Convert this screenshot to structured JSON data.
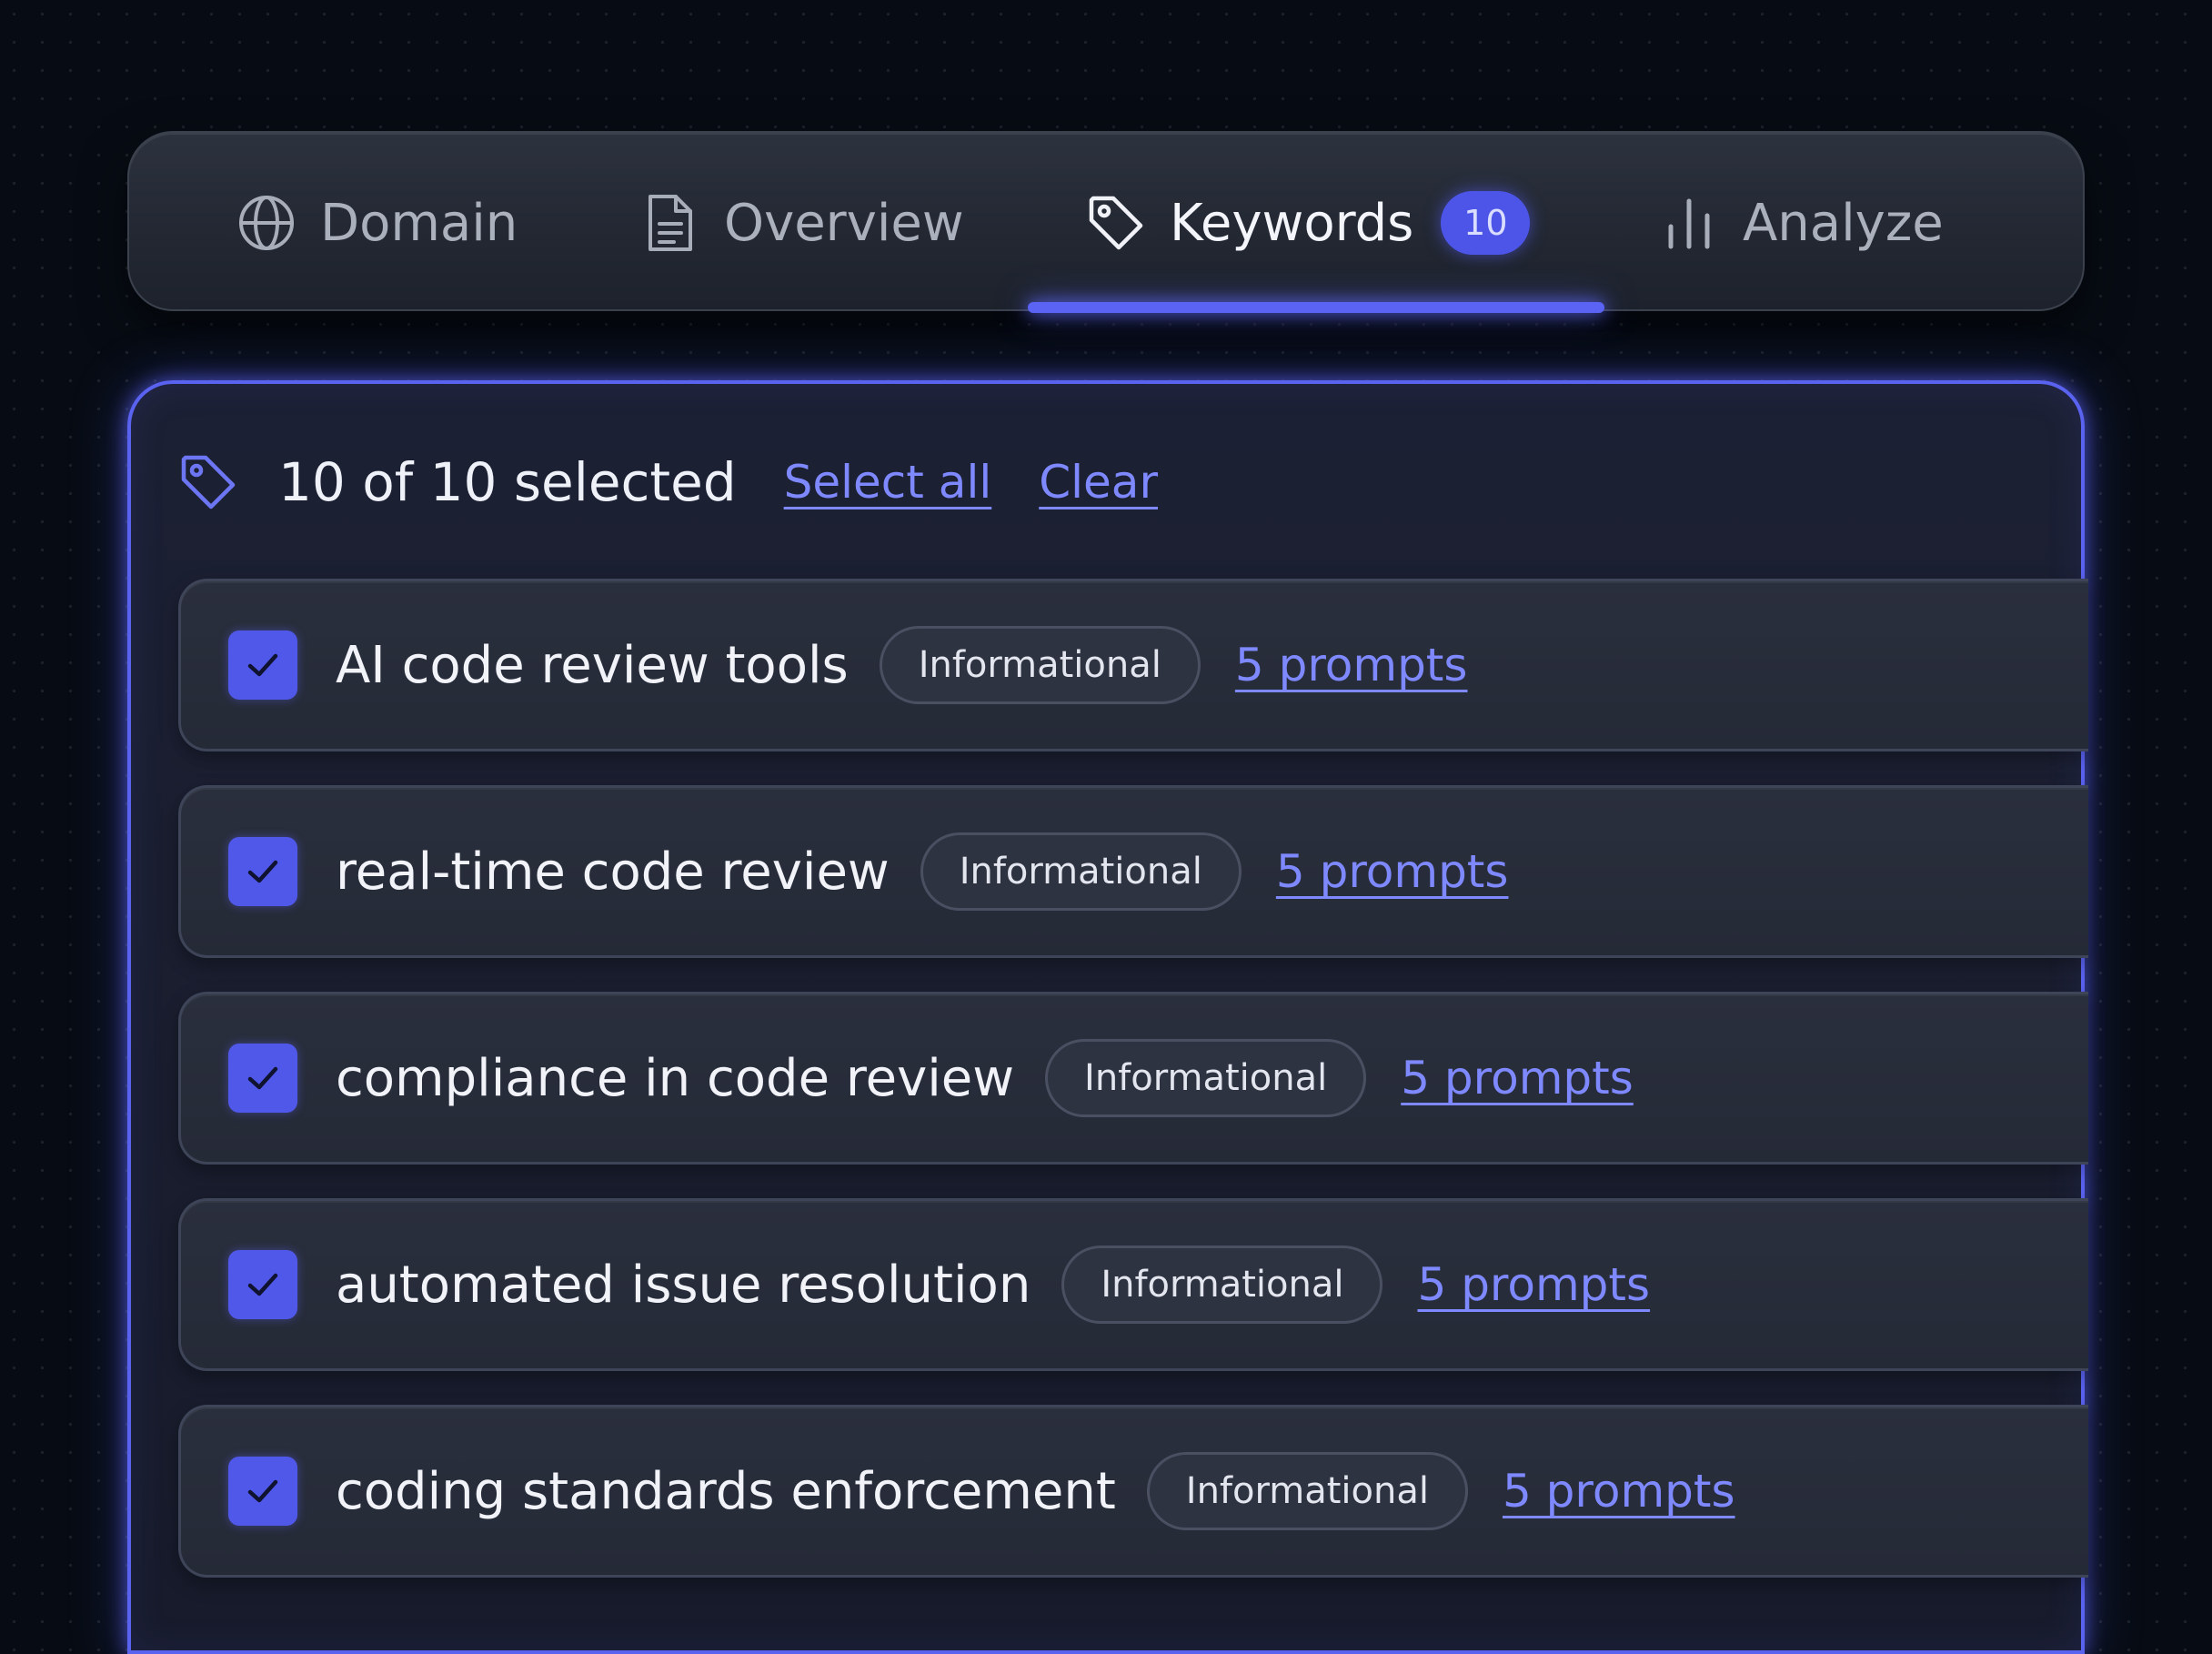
{
  "tabs": [
    {
      "label": "Domain",
      "icon": "globe-icon",
      "active": false
    },
    {
      "label": "Overview",
      "icon": "document-icon",
      "active": false
    },
    {
      "label": "Keywords",
      "icon": "tag-icon",
      "active": true,
      "badge": "10"
    },
    {
      "label": "Analyze",
      "icon": "bar-chart-icon",
      "active": false
    }
  ],
  "panel": {
    "header_icon": "tag-icon",
    "selected_text": "10 of 10 selected",
    "select_all_label": "Select all",
    "clear_label": "Clear"
  },
  "keywords": [
    {
      "label": "AI code review tools",
      "intent": "Informational",
      "prompts": "5 prompts",
      "checked": true
    },
    {
      "label": "real-time code review",
      "intent": "Informational",
      "prompts": "5 prompts",
      "checked": true
    },
    {
      "label": "compliance in code review",
      "intent": "Informational",
      "prompts": "5 prompts",
      "checked": true
    },
    {
      "label": "automated issue resolution",
      "intent": "Informational",
      "prompts": "5 prompts",
      "checked": true
    },
    {
      "label": "coding standards enforcement",
      "intent": "Informational",
      "prompts": "5 prompts",
      "checked": true
    }
  ],
  "colors": {
    "accent": "#5058ea",
    "link": "#7f89ff",
    "background": "#070c14"
  }
}
